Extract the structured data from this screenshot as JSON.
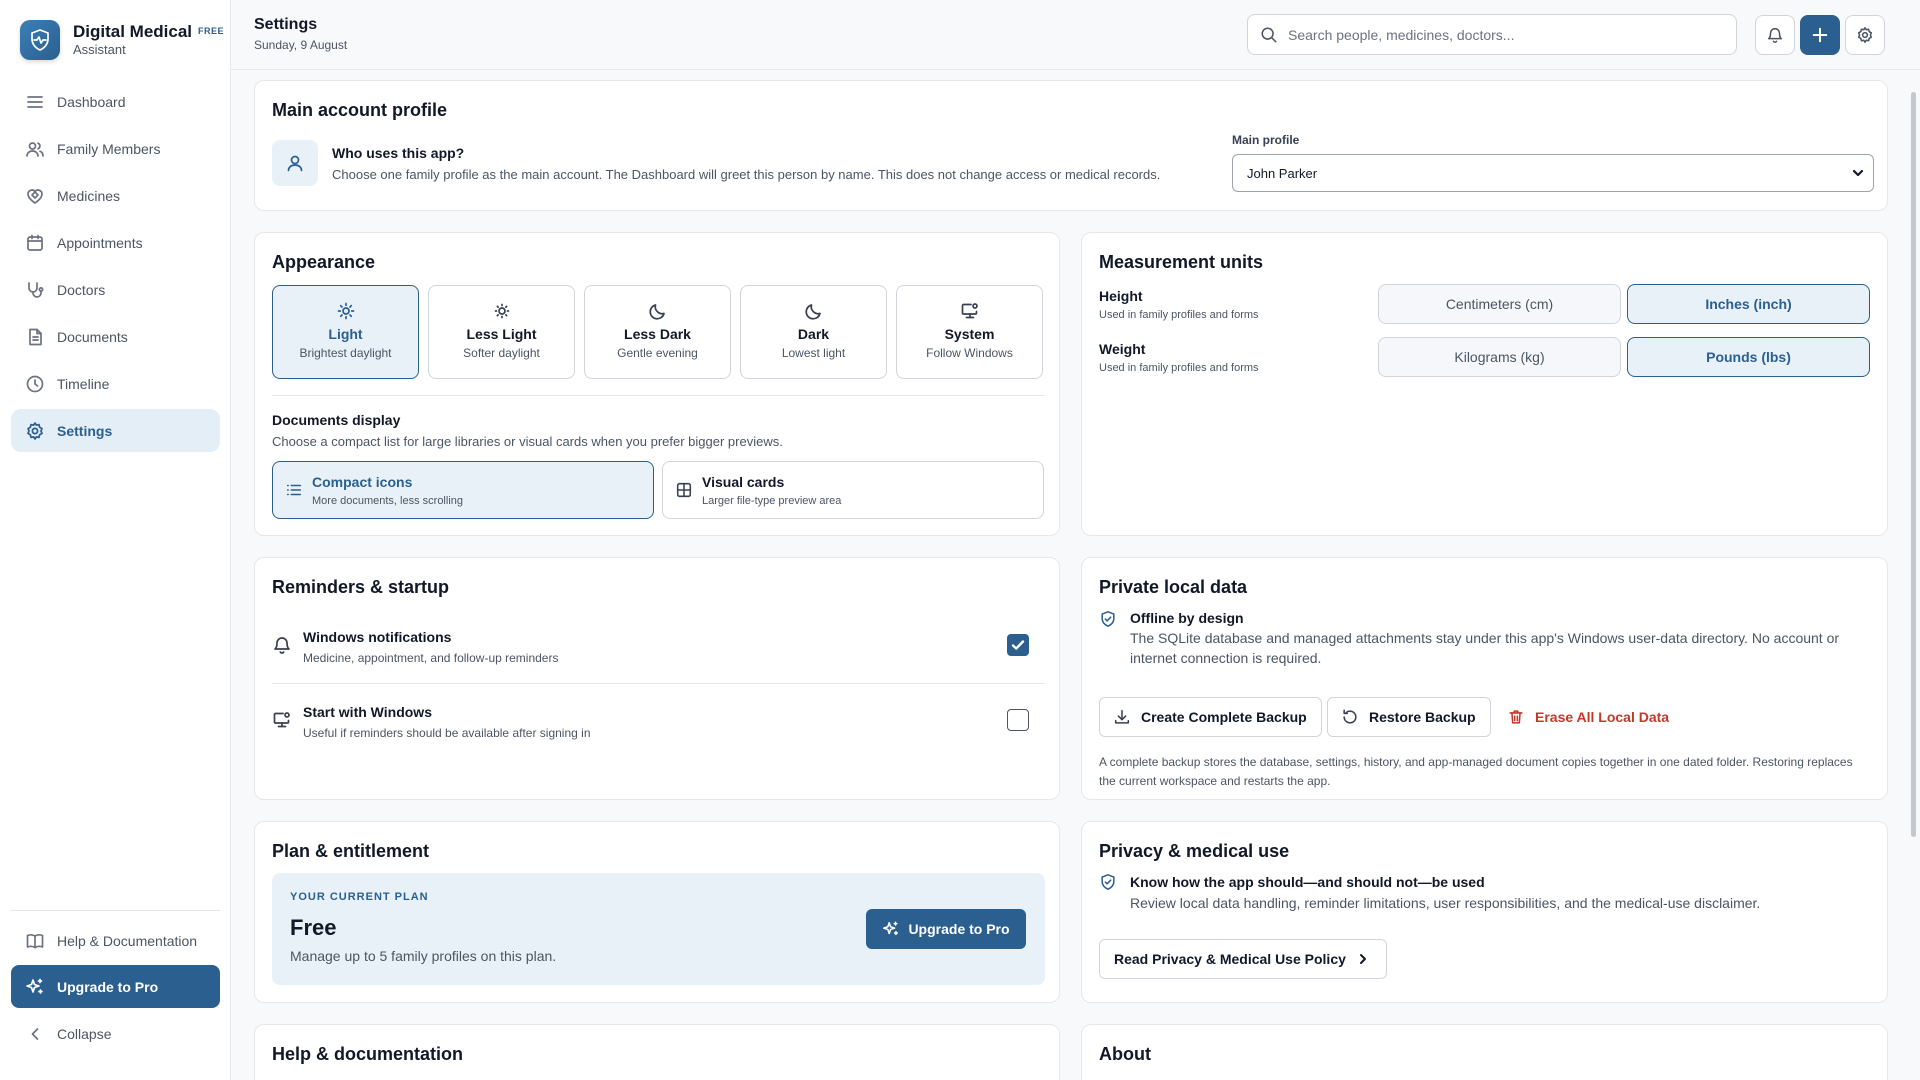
{
  "app": {
    "name": "Digital Medical",
    "badge": "FREE",
    "subtitle": "Assistant"
  },
  "sidebar": {
    "items": [
      {
        "label": "Dashboard",
        "icon": "menu-icon"
      },
      {
        "label": "Family Members",
        "icon": "users-icon"
      },
      {
        "label": "Medicines",
        "icon": "heart-pill-icon"
      },
      {
        "label": "Appointments",
        "icon": "calendar-icon"
      },
      {
        "label": "Doctors",
        "icon": "stethoscope-icon"
      },
      {
        "label": "Documents",
        "icon": "document-icon"
      },
      {
        "label": "Timeline",
        "icon": "clock-icon"
      },
      {
        "label": "Settings",
        "icon": "gear-icon",
        "active": true
      }
    ],
    "help_label": "Help & Documentation",
    "upgrade_label": "Upgrade to Pro",
    "collapse_label": "Collapse"
  },
  "header": {
    "title": "Settings",
    "date": "Sunday, 9 August",
    "search_placeholder": "Search people, medicines, doctors..."
  },
  "profile": {
    "title": "Main account profile",
    "question": "Who uses this app?",
    "description": "Choose one family profile as the main account. The Dashboard will greet this person by name. This does not change access or medical records.",
    "select_label": "Main profile",
    "selected": "John Parker"
  },
  "appearance": {
    "title": "Appearance",
    "themes": [
      {
        "label": "Light",
        "sub": "Brightest daylight",
        "selected": true
      },
      {
        "label": "Less Light",
        "sub": "Softer daylight"
      },
      {
        "label": "Less Dark",
        "sub": "Gentle evening"
      },
      {
        "label": "Dark",
        "sub": "Lowest light"
      },
      {
        "label": "System",
        "sub": "Follow Windows"
      }
    ],
    "docs_title": "Documents display",
    "docs_desc": "Choose a compact list for large libraries or visual cards when you prefer bigger previews.",
    "doc_options": [
      {
        "label": "Compact icons",
        "sub": "More documents, less scrolling",
        "selected": true
      },
      {
        "label": "Visual cards",
        "sub": "Larger file-type preview area"
      }
    ]
  },
  "units": {
    "title": "Measurement units",
    "height": {
      "label": "Height",
      "desc": "Used in family profiles and forms",
      "options": [
        "Centimeters (cm)",
        "Inches (inch)"
      ],
      "selected": "Inches (inch)"
    },
    "weight": {
      "label": "Weight",
      "desc": "Used in family profiles and forms",
      "options": [
        "Kilograms (kg)",
        "Pounds (lbs)"
      ],
      "selected": "Pounds (lbs)"
    }
  },
  "reminders": {
    "title": "Reminders & startup",
    "notifications": {
      "label": "Windows notifications",
      "desc": "Medicine, appointment, and follow-up reminders",
      "checked": true
    },
    "startup": {
      "label": "Start with Windows",
      "desc": "Useful if reminders should be available after signing in",
      "checked": false
    }
  },
  "private_data": {
    "title": "Private local data",
    "heading": "Offline by design",
    "description": "The SQLite database and managed attachments stay under this app's Windows user-data directory. No account or internet connection is required.",
    "backup_label": "Create Complete Backup",
    "restore_label": "Restore Backup",
    "erase_label": "Erase All Local Data",
    "note": "A complete backup stores the database, settings, history, and app-managed document copies together in one dated folder. Restoring replaces the current workspace and restarts the app."
  },
  "plan": {
    "title": "Plan & entitlement",
    "current_label": "YOUR CURRENT PLAN",
    "name": "Free",
    "desc": "Manage up to 5 family profiles on this plan.",
    "upgrade_label": "Upgrade to Pro"
  },
  "privacy": {
    "title": "Privacy & medical use",
    "heading": "Know how the app should—and should not—be used",
    "desc": "Review local data handling, reminder limitations, user responsibilities, and the medical-use disclaimer.",
    "button": "Read Privacy & Medical Use Policy"
  },
  "help_section": {
    "title": "Help & documentation"
  },
  "about_section": {
    "title": "About"
  },
  "colors": {
    "accent": "#2a5f8f",
    "accent_light": "#e8f1f8",
    "danger": "#c0392b"
  }
}
